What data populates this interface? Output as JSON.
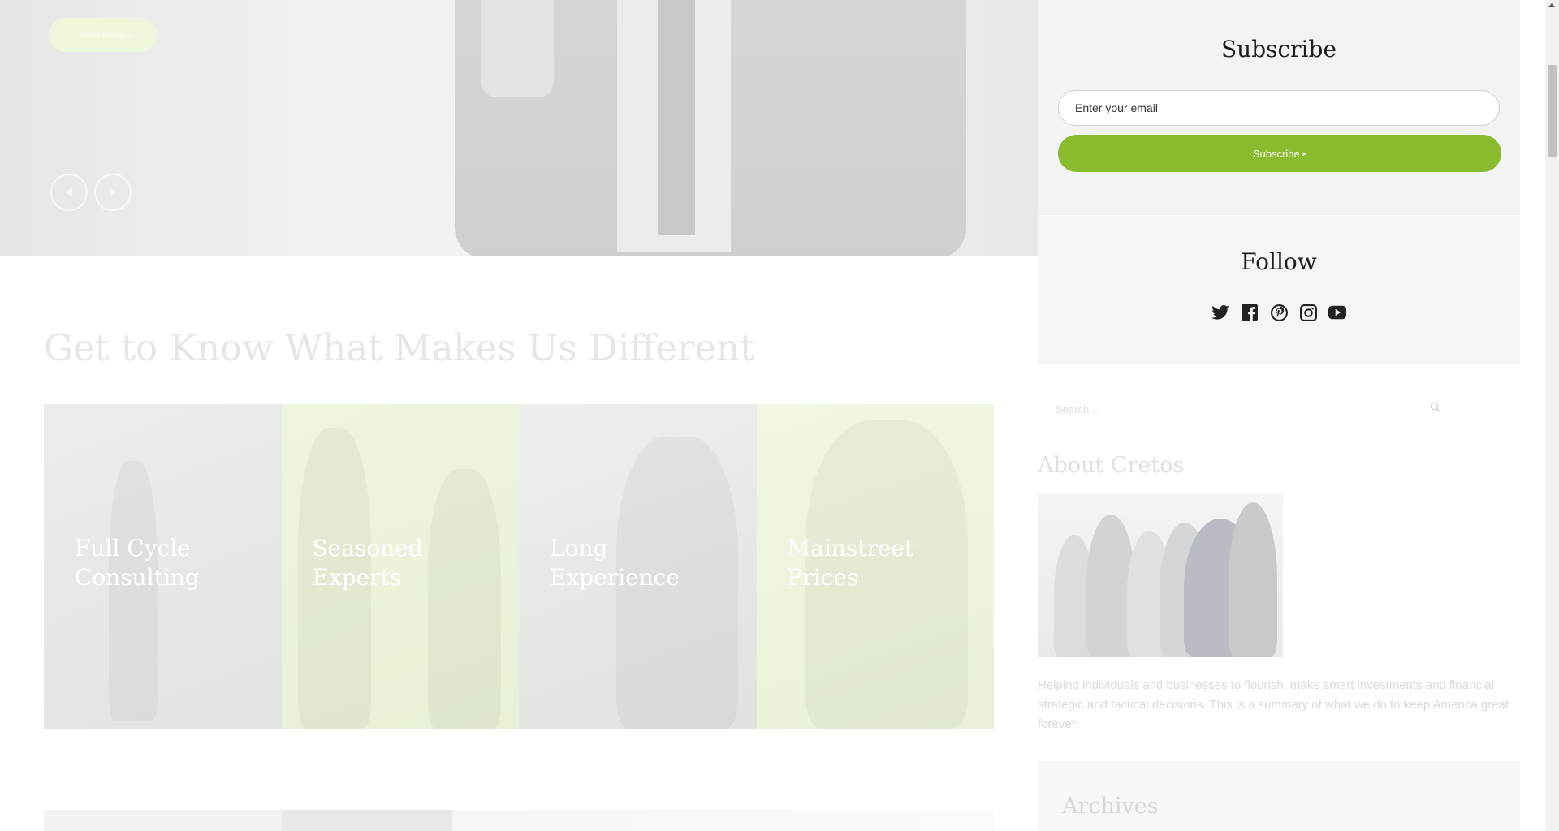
{
  "hero": {
    "learn_more_label": "Learn more",
    "prev_icon": "chevron-left-icon",
    "next_icon": "chevron-right-icon"
  },
  "section": {
    "title": "Get to Know What Makes Us Different",
    "tiles": [
      {
        "line1": "Full Cycle",
        "line2": "Consulting"
      },
      {
        "line1": "Seasoned",
        "line2": "Experts"
      },
      {
        "line1": "Long",
        "line2": "Experience"
      },
      {
        "line1": "Mainstreet",
        "line2": "Prices"
      }
    ]
  },
  "sidebar": {
    "subscribe": {
      "title": "Subscribe",
      "email_placeholder": "Enter your email",
      "button_label": "Subscribe"
    },
    "follow": {
      "title": "Follow",
      "icons": [
        "twitter-icon",
        "facebook-icon",
        "pinterest-icon",
        "instagram-icon",
        "youtube-icon"
      ]
    },
    "search": {
      "placeholder": "Search ..."
    },
    "about": {
      "title": "About Cretos",
      "text": "Helping individuals and businesses to flourish, make smart investments and financial strategic and tactical decisions. This is a summary of what we do to keep America great forever!"
    },
    "archives": {
      "title": "Archives"
    }
  },
  "colors": {
    "accent": "#8aba2e",
    "widget_bg": "#f3f3f3",
    "heading": "#1d1d1d"
  }
}
